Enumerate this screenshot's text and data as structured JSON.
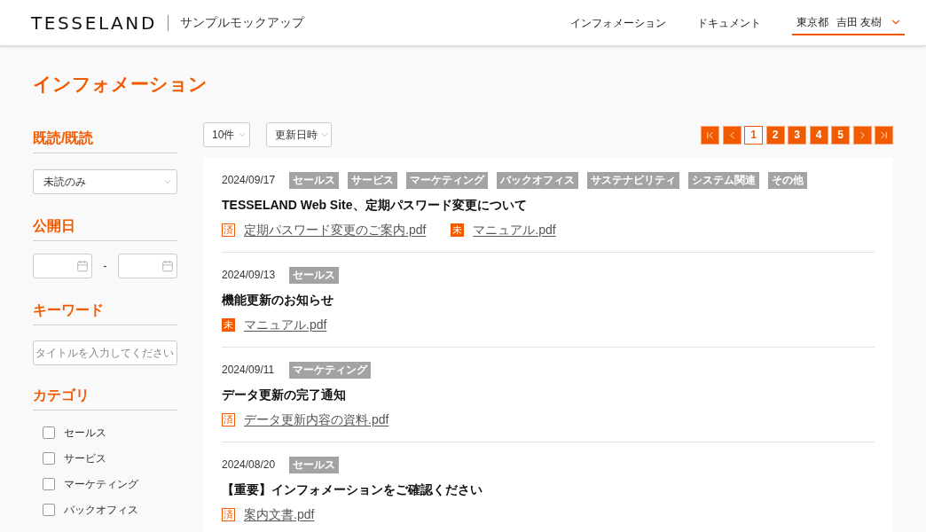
{
  "header": {
    "logo": "TESSELAND",
    "subtitle": "サンプルモックアップ",
    "nav": [
      "インフォメーション",
      "ドキュメント"
    ],
    "user": {
      "region": "東京都",
      "name": "吉田 友樹"
    }
  },
  "page_title": "インフォメーション",
  "filters": {
    "read_status": {
      "heading": "既読/既読",
      "value": "未読のみ"
    },
    "publish_date": {
      "heading": "公開日",
      "separator": "-"
    },
    "keyword": {
      "heading": "キーワード",
      "placeholder": "タイトルを入力してください"
    },
    "category": {
      "heading": "カテゴリ",
      "options": [
        {
          "label": "セールス",
          "checked": false
        },
        {
          "label": "サービス",
          "checked": false
        },
        {
          "label": "マーケティング",
          "checked": false
        },
        {
          "label": "バックオフィス",
          "checked": false
        }
      ]
    }
  },
  "toolbar": {
    "per_page": "10件",
    "sort": "更新日時"
  },
  "pagination": {
    "pages": [
      {
        "label": "1",
        "selected": true
      },
      {
        "label": "2",
        "selected": false
      },
      {
        "label": "3",
        "selected": false
      },
      {
        "label": "4",
        "selected": false
      },
      {
        "label": "5",
        "selected": false
      }
    ]
  },
  "items": [
    {
      "date": "2024/09/17",
      "tags": [
        "セールス",
        "サービス",
        "マーケティング",
        "バックオフィス",
        "サステナビリティ",
        "システム関連",
        "その他"
      ],
      "title": "TESSELAND Web Site、定期パスワード変更について",
      "files": [
        {
          "badge": "済",
          "read": true,
          "name": "定期パスワード変更のご案内.pdf"
        },
        {
          "badge": "未",
          "read": false,
          "name": "マニュアル.pdf"
        }
      ]
    },
    {
      "date": "2024/09/13",
      "tags": [
        "セールス"
      ],
      "title": "機能更新のお知らせ",
      "files": [
        {
          "badge": "未",
          "read": false,
          "name": "マニュアル.pdf"
        }
      ]
    },
    {
      "date": "2024/09/11",
      "tags": [
        "マーケティング"
      ],
      "title": "データ更新の完了通知",
      "files": [
        {
          "badge": "済",
          "read": true,
          "name": "データ更新内容の資料.pdf"
        }
      ]
    },
    {
      "date": "2024/08/20",
      "tags": [
        "セールス"
      ],
      "title": "【重要】インフォメーションをご確認ください",
      "files": [
        {
          "badge": "済",
          "read": true,
          "name": "案内文書.pdf"
        }
      ]
    }
  ]
}
